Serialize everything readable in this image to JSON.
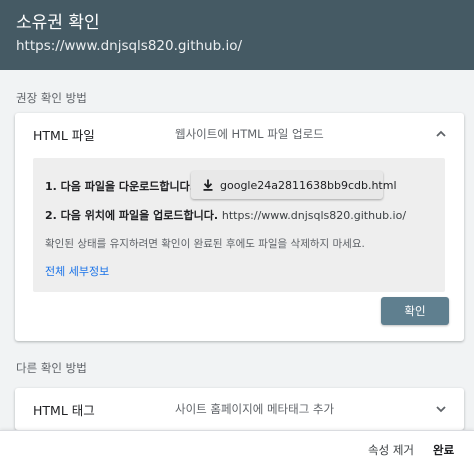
{
  "header": {
    "title": "소유권 확인",
    "url": "https://www.dnjsqls820.github.io/"
  },
  "recommended": {
    "section_label": "권장 확인 방법",
    "method_name": "HTML 파일",
    "method_desc": "웹사이트에 HTML 파일 업로드",
    "expand_icon": "chevron-up-icon",
    "step1_label": "1. 다음 파일을 다운로드합니다.",
    "download_icon": "download-icon",
    "download_file": "google24a2811638bb9cdb.html",
    "step2_label": "2. 다음 위치에 파일을 업로드합니다.",
    "step2_url": "https://www.dnjsqls820.github.io/",
    "hint": "확인된 상태를 유지하려면 확인이 완료된 후에도 파일을 삭제하지 마세요.",
    "details_link": "전체 세부정보",
    "confirm_button": "확인"
  },
  "other": {
    "section_label": "다른 확인 방법",
    "method_name": "HTML 태그",
    "method_desc": "사이트 홈페이지에 메타태그 추가",
    "expand_icon": "chevron-down-icon"
  },
  "footer": {
    "remove_label": "속성 제거",
    "done_label": "완료"
  },
  "colors": {
    "header_bg": "#455a64",
    "confirm_bg": "#5f7f8f",
    "link": "#1a73e8",
    "page_bg": "#f1f3f4"
  }
}
